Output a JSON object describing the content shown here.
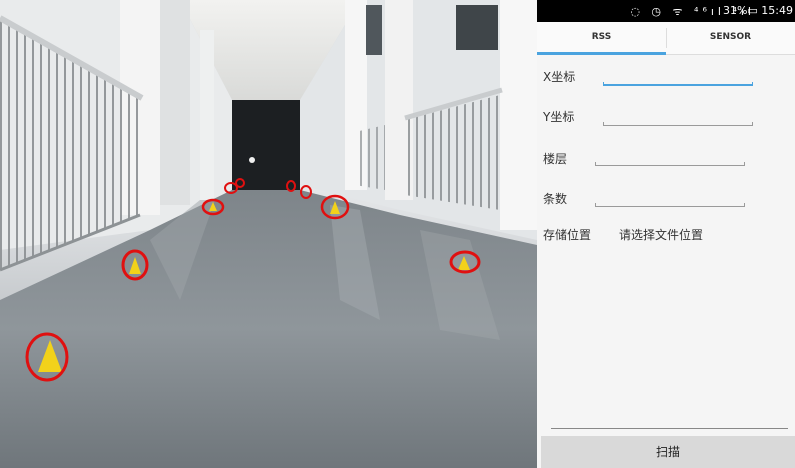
{
  "statusbar": {
    "icons": "◌ ◷ ᯤ ⁴⁶ıl ⁴ıl",
    "time": "31%▭ 15:49"
  },
  "tabs": [
    {
      "label": "RSS",
      "active": true
    },
    {
      "label": "SENSOR",
      "active": false
    }
  ],
  "form": {
    "x_label": "X坐标",
    "x_value": "",
    "y_label": "Y坐标",
    "y_value": "",
    "floor_label": "楼层",
    "floor_value": "",
    "count_label": "条数",
    "count_value": "",
    "store_label": "存储位置",
    "store_value": "请选择文件位置"
  },
  "scan_button": "扫描",
  "colors": {
    "accent": "#4aa3df",
    "marker": "#e01010",
    "cone": "#f2d21a"
  }
}
